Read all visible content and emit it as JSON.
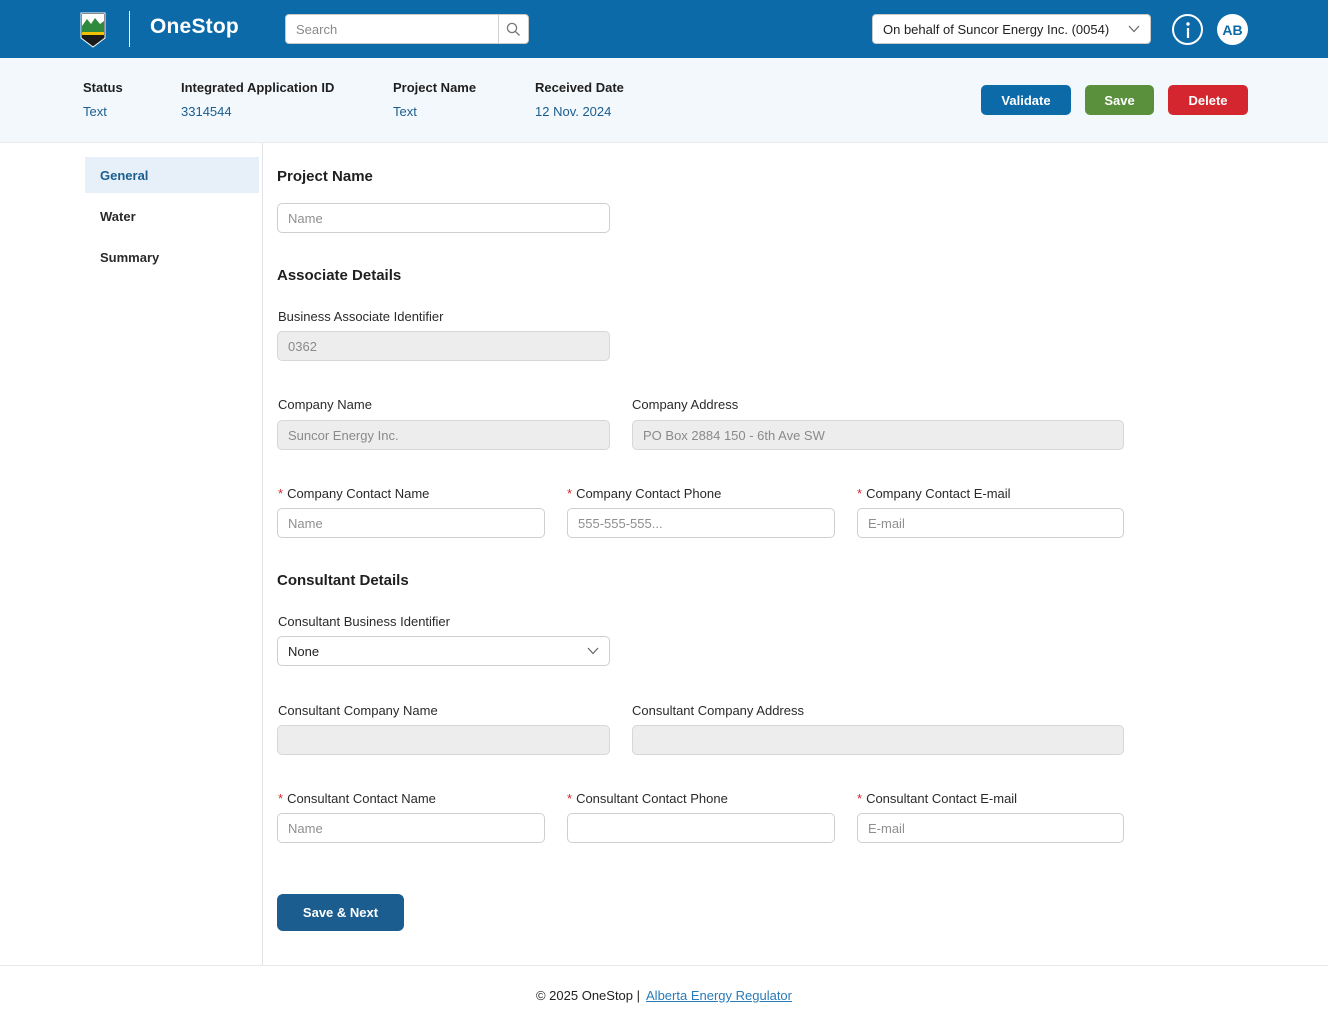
{
  "header": {
    "brand": "OneStop",
    "search_placeholder": "Search",
    "behalf_label": "On behalf of Suncor Energy Inc. (0054)",
    "avatar_initials": "AB",
    "colors": {
      "primary": "#0c6aa8",
      "save": "#5a8f3c",
      "delete": "#d3262f"
    }
  },
  "summary": {
    "status_label": "Status",
    "status_value": "Text",
    "app_id_label": "Integrated Application ID",
    "app_id_value": "3314544",
    "project_name_label": "Project Name",
    "project_name_value": "Text",
    "received_label": "Received Date",
    "received_value": "12 Nov. 2024",
    "validate_label": "Validate",
    "save_label": "Save",
    "delete_label": "Delete"
  },
  "sidebar": {
    "items": [
      {
        "label": "General",
        "active": true
      },
      {
        "label": "Water",
        "active": false
      },
      {
        "label": "Summary",
        "active": false
      }
    ]
  },
  "form": {
    "project_name_title": "Project Name",
    "project_name_placeholder": "Name",
    "associate_title": "Associate Details",
    "ba_id_label": "Business Associate Identifier",
    "ba_id_value": "0362",
    "company_name_label": "Company Name",
    "company_name_value": "Suncor Energy Inc.",
    "company_address_label": "Company Address",
    "company_address_value": "PO Box 2884 150 - 6th Ave SW",
    "contact_name_label": "Company Contact Name",
    "contact_name_placeholder": "Name",
    "contact_phone_label": "Company Contact Phone",
    "contact_phone_placeholder": "555-555-555...",
    "contact_email_label": "Company Contact E-mail",
    "contact_email_placeholder": "E-mail",
    "consultant_title": "Consultant Details",
    "consultant_id_label": "Consultant Business Identifier",
    "consultant_id_value": "None",
    "consultant_company_label": "Consultant Company Name",
    "consultant_address_label": "Consultant Company Address",
    "cons_contact_name_label": "Consultant Contact Name",
    "cons_contact_name_placeholder": "Name",
    "cons_contact_phone_label": "Consultant Contact Phone",
    "cons_contact_email_label": "Consultant Contact E-mail",
    "cons_contact_email_placeholder": "E-mail",
    "required_marker": "*",
    "save_next_label": "Save & Next"
  },
  "footer": {
    "copyright": "© 2025 OneStop |",
    "link": "Alberta Energy Regulator"
  }
}
